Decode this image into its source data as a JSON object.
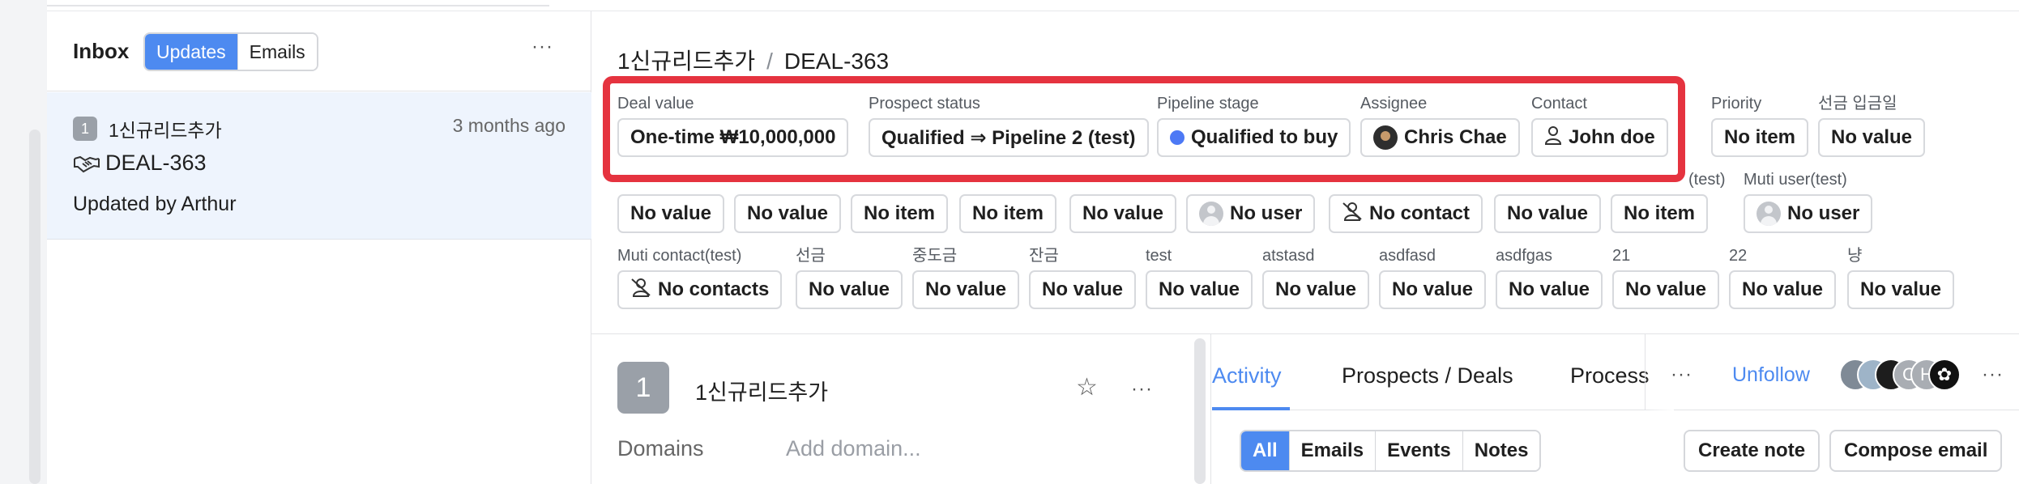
{
  "inbox": {
    "title": "Inbox",
    "tabs": [
      "Updates",
      "Emails"
    ],
    "active_tab": "Updates",
    "more_icon": "ellipsis-icon",
    "item": {
      "number": "1",
      "company": "1신규리드추가",
      "time": "3 months ago",
      "deal_icon": "handshake-icon",
      "deal": "DEAL-363",
      "updated": "Updated by Arthur"
    }
  },
  "breadcrumb": {
    "company": "1신규리드추가",
    "separator": "/",
    "deal": "DEAL-363"
  },
  "fields_row1": [
    {
      "label": "Deal value",
      "value": "One-time ₩10,000,000"
    },
    {
      "label": "Prospect status",
      "value": "Qualified ⇒ Pipeline 2 (test)"
    },
    {
      "label": "Pipeline stage",
      "value": "Qualified to buy",
      "dot_color": "#4d79f5"
    },
    {
      "label": "Assignee",
      "value": "Chris Chae"
    },
    {
      "label": "Contact",
      "value": "John doe"
    },
    {
      "label": "Priority",
      "value": "No item"
    },
    {
      "label": "선금 입금일",
      "value": "No value"
    }
  ],
  "fields_row2": [
    {
      "label": "",
      "value": "No value"
    },
    {
      "label": "",
      "value": "No value"
    },
    {
      "label": "",
      "value": "No item"
    },
    {
      "label": "",
      "value": "No item"
    },
    {
      "label": "",
      "value": "No value"
    },
    {
      "label": "",
      "value": "No user"
    },
    {
      "label": "",
      "value": "No contact"
    },
    {
      "label": "",
      "value": "No value"
    },
    {
      "label": "(test)",
      "value": "No item"
    },
    {
      "label": "Muti user(test)",
      "value": "No user"
    }
  ],
  "fields_row3": [
    {
      "label": "Muti contact(test)",
      "value": "No contacts"
    },
    {
      "label": "선금",
      "value": "No value"
    },
    {
      "label": "중도금",
      "value": "No value"
    },
    {
      "label": "잔금",
      "value": "No value"
    },
    {
      "label": "test",
      "value": "No value"
    },
    {
      "label": "atstasd",
      "value": "No value"
    },
    {
      "label": "asdfasd",
      "value": "No value"
    },
    {
      "label": "asdfgas",
      "value": "No value"
    },
    {
      "label": "21",
      "value": "No value"
    },
    {
      "label": "22",
      "value": "No value"
    },
    {
      "label": "냥",
      "value": "No value"
    }
  ],
  "company_card": {
    "number": "1",
    "name": "1신규리드추가",
    "domains_label": "Domains",
    "domains_placeholder": "Add domain..."
  },
  "activity": {
    "tabs": [
      "Activity",
      "Prospects / Deals",
      "Process"
    ],
    "active_tab": "Activity",
    "unfollow": "Unfollow",
    "avatar_letters": [
      "C",
      "H"
    ],
    "filters": [
      "All",
      "Emails",
      "Events",
      "Notes"
    ],
    "active_filter": "All",
    "create_note": "Create note",
    "compose_email": "Compose email"
  },
  "colors": {
    "accent": "#4d8af0",
    "highlight_border": "#e5333f",
    "selected_item_bg": "#eef4fd"
  }
}
